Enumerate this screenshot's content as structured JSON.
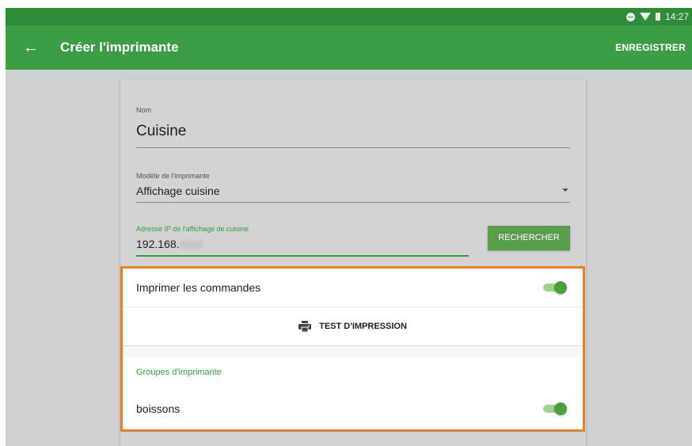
{
  "status_bar": {
    "time": "14:27"
  },
  "app_bar": {
    "title": "Créer l'imprimante",
    "save_label": "ENREGISTRER"
  },
  "form": {
    "name": {
      "label": "Nom",
      "value": "Cuisine"
    },
    "model": {
      "label": "Modèle de l'imprimante",
      "value": "Affichage cuisine"
    },
    "ip": {
      "label": "Adresse IP de l'affichage de cuisine",
      "value": "192.168."
    },
    "search_label": "RECHERCHER"
  },
  "print_orders": {
    "label": "Imprimer les commandes",
    "enabled": true
  },
  "test_print": {
    "label": "TEST D'IMPRESSION"
  },
  "printer_groups": {
    "title": "Groupes d'imprimante",
    "items": [
      {
        "label": "boissons",
        "enabled": true
      }
    ]
  },
  "colors": {
    "status_bar": "#2f8c3a",
    "app_bar": "#3b9e45",
    "accent": "#3b9e45",
    "highlight_border": "#e57f2a",
    "toggle_on": "#4ca03b"
  }
}
